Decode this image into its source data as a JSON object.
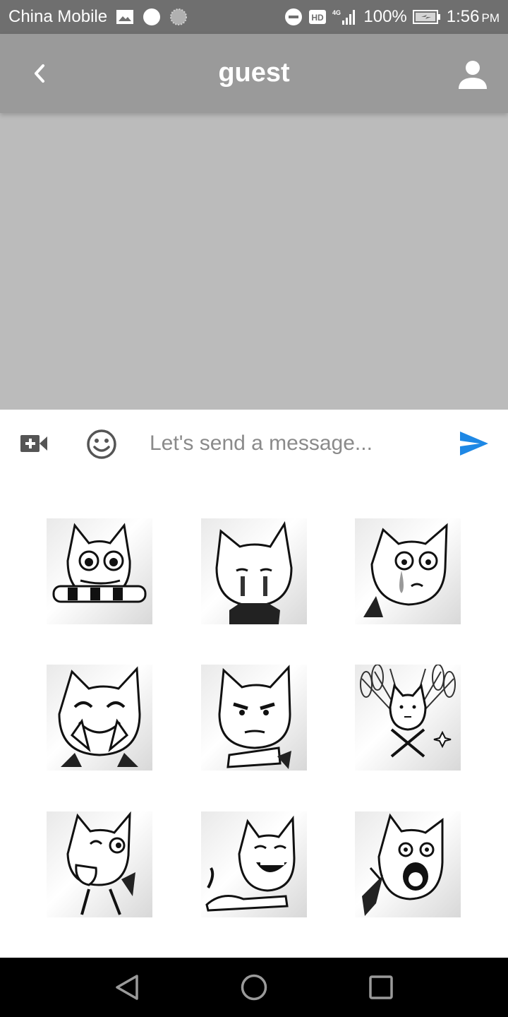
{
  "status_bar": {
    "carrier": "China Mobile",
    "network": "4G",
    "battery": "100%",
    "time": "1:56",
    "time_suffix": "PM",
    "icons": [
      "image-icon",
      "circle-icon",
      "loading-icon",
      "dnd-icon",
      "hd-icon",
      "signal-icon",
      "battery-icon"
    ]
  },
  "app_bar": {
    "title": "guest",
    "back_icon": "chevron-left-icon",
    "profile_icon": "person-icon"
  },
  "composer": {
    "placeholder": "Let's send a message...",
    "value": "",
    "video_icon": "video-add-icon",
    "emoji_icon": "emoji-icon",
    "send_icon": "send-icon",
    "send_color": "#1e88e5"
  },
  "stickers": [
    {
      "name": "sticker-cat-biting",
      "mood": "biting"
    },
    {
      "name": "sticker-cat-crying-quiet",
      "mood": "crying"
    },
    {
      "name": "sticker-cat-teary",
      "mood": "teary"
    },
    {
      "name": "sticker-cat-giggling",
      "mood": "giggling"
    },
    {
      "name": "sticker-cat-arms-crossed",
      "mood": "serious"
    },
    {
      "name": "sticker-cat-peacock",
      "mood": "peacock"
    },
    {
      "name": "sticker-cat-tongue",
      "mood": "tongue"
    },
    {
      "name": "sticker-cat-lounging",
      "mood": "lounging"
    },
    {
      "name": "sticker-cat-screaming",
      "mood": "screaming"
    }
  ],
  "nav_bar": {
    "icons": [
      "back-triangle-icon",
      "home-circle-icon",
      "recents-square-icon"
    ]
  },
  "colors": {
    "status_bar": "#6f6f6f",
    "app_bar": "#9a9a9a",
    "message_area": "#bbbbbb",
    "send": "#1e88e5"
  }
}
